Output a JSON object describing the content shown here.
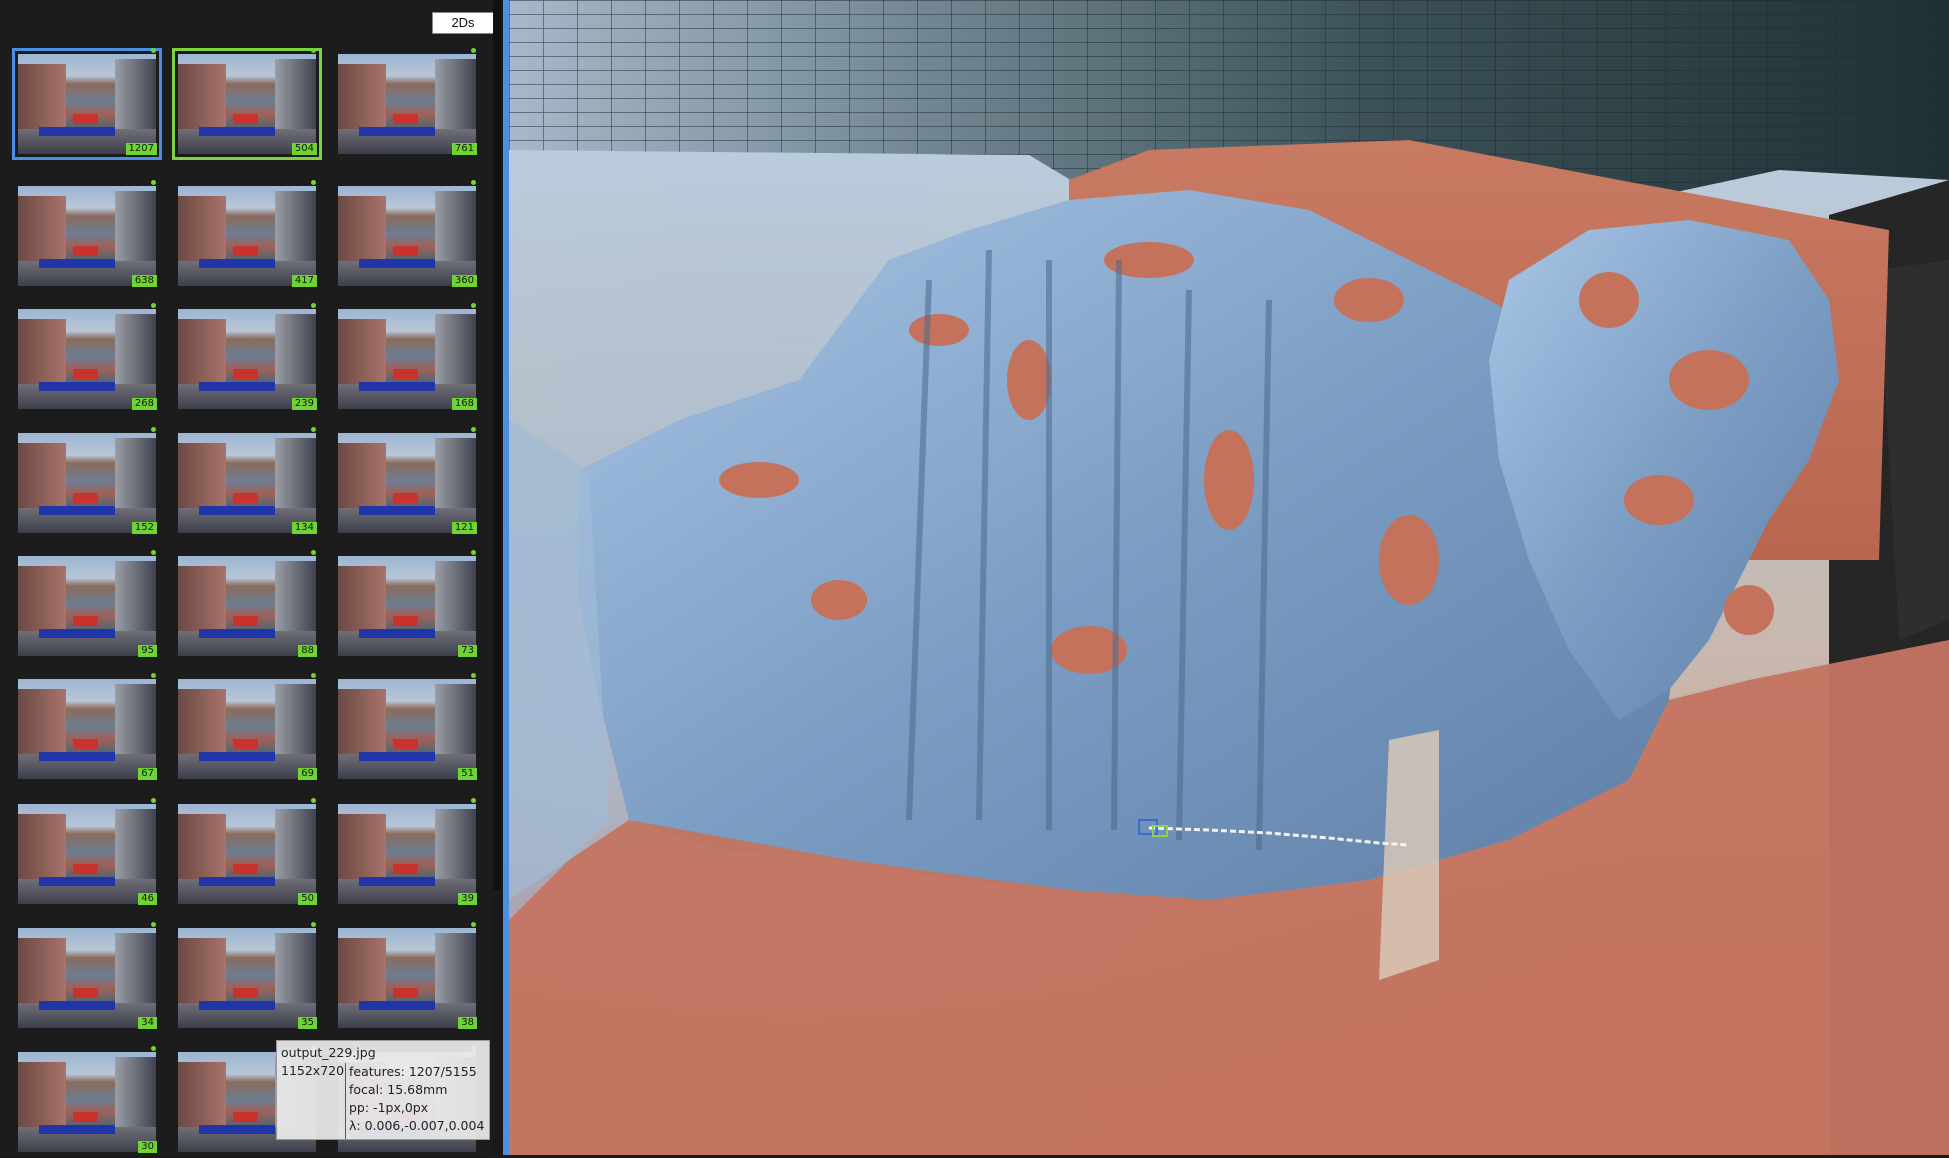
{
  "panel": {
    "button_label": "2Ds",
    "thumbnails": [
      {
        "count": "1207",
        "selection": "blue"
      },
      {
        "count": "504",
        "selection": "green"
      },
      {
        "count": "761",
        "selection": ""
      },
      {
        "count": "638",
        "selection": ""
      },
      {
        "count": "417",
        "selection": ""
      },
      {
        "count": "360",
        "selection": ""
      },
      {
        "count": "268",
        "selection": ""
      },
      {
        "count": "239",
        "selection": ""
      },
      {
        "count": "168",
        "selection": ""
      },
      {
        "count": "152",
        "selection": ""
      },
      {
        "count": "134",
        "selection": ""
      },
      {
        "count": "121",
        "selection": ""
      },
      {
        "count": "95",
        "selection": ""
      },
      {
        "count": "88",
        "selection": ""
      },
      {
        "count": "73",
        "selection": ""
      },
      {
        "count": "67",
        "selection": ""
      },
      {
        "count": "69",
        "selection": ""
      },
      {
        "count": "51",
        "selection": ""
      },
      {
        "count": "46",
        "selection": ""
      },
      {
        "count": "50",
        "selection": ""
      },
      {
        "count": "39",
        "selection": ""
      },
      {
        "count": "34",
        "selection": ""
      },
      {
        "count": "35",
        "selection": ""
      },
      {
        "count": "38",
        "selection": ""
      },
      {
        "count": "30",
        "selection": ""
      },
      {
        "count": "",
        "selection": ""
      },
      {
        "count": "",
        "selection": ""
      }
    ]
  },
  "tooltip": {
    "filename": "output_229.jpg",
    "resolution": "1152x720",
    "features": "features: 1207/5155",
    "focal": "focal: 15.68mm",
    "pp": "pp: -1px,0px",
    "lambda": "λ: 0.006,-0.007,0.004"
  },
  "colors": {
    "accent_blue": "#4a90e2",
    "selection_green": "#7dd33f",
    "count_badge": "#6fd334",
    "mesh_blue": "#8fb2d8",
    "mesh_orange": "#c5705a"
  }
}
